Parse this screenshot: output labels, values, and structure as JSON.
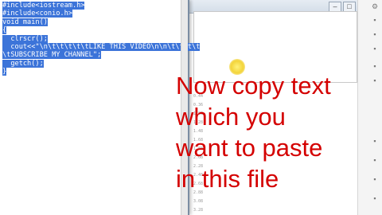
{
  "editor": {
    "selected_code_lines": [
      "#include<iostream.h>",
      "#include<conio.h>",
      "void main()",
      "{",
      "  clrscr();",
      "  cout<<\"\\n\\t\\t\\t\\t\\tLIKE THIS VIDEO\\n\\n\\t\\t\\t\\t",
      "\\tSUBSCRIBE MY CHANNEL\";",
      "  getch();",
      "}"
    ]
  },
  "overlay": {
    "caption_lines": [
      "Now copy text",
      "which you",
      "want to paste",
      "in this file"
    ],
    "color": "#d40000"
  },
  "background_window": {
    "ruler_marks": [
      "0.44",
      "0.36",
      "1.08",
      "1.28",
      "1.48",
      "1.68",
      "1.88",
      "2.08",
      "2.28",
      "2.48",
      "2.68",
      "2.88",
      "3.08",
      "3.28"
    ]
  },
  "colors": {
    "selection": "#3c74d9",
    "caption": "#d40000"
  }
}
